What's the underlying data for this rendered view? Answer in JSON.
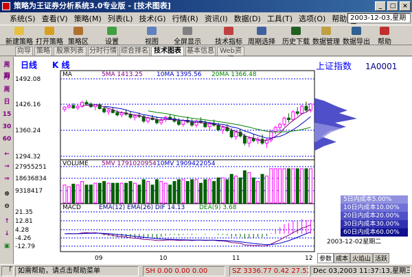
{
  "window": {
    "title": "策略为王证券分析系统3.0专业版 - [技术图表]"
  },
  "menu": [
    "系统(S)",
    "查看(V)",
    "策略(M)",
    "列表(L)",
    "技术(G)",
    "行情(R)",
    "资讯(I)",
    "数据(D)",
    "工具(T)",
    "选项(O)",
    "帮助(H)"
  ],
  "date_display": "2003-12-03,星期三",
  "toolbar": [
    "新建策略",
    "打开策略",
    "策略区",
    "设置",
    "视图",
    "全屏显示",
    "技术指标",
    "周期选择",
    "历史下载",
    "数据管理",
    "数据导出",
    "帮助"
  ],
  "tabs": [
    "向导",
    "策略",
    "股票列表",
    "分时行情",
    "综合排名",
    "技术图表",
    "基本信息",
    "Web资讯"
  ],
  "active_tab": "技术图表",
  "left_tools": [
    "周期",
    "月",
    "周",
    "日",
    "15",
    "30",
    "60",
    "←",
    "→",
    "⇒",
    "⊕",
    "⊖",
    "↑",
    "↓",
    "▣"
  ],
  "chart": {
    "period_label": "日线",
    "type_label": "K  线",
    "stock_name": "上证指数",
    "stock_code": "1A0001",
    "ma_label": "MA",
    "ma5": "5MA 1413.25",
    "ma10": "10MA 1395.56",
    "ma20": "20MA 1366.48",
    "price_axis": [
      "1492.08",
      "1426.16",
      "1360.24",
      "1294.32"
    ],
    "volume_label": "VOLUME",
    "mv5": "5MV 1791020954",
    "mv10": "10MV 1909422054",
    "vol_axis": [
      "27955251",
      "18636834",
      "9318417"
    ],
    "macd_label": "MACD",
    "macd_params": "EMA(12) EMA(26) DIF 14.13",
    "dea_label": "DEA(9) 3.68",
    "macd_axis": [
      "21.35",
      "12.81",
      "4.28",
      "-4.26",
      "-12.79"
    ],
    "x_axis": [
      "09",
      "10",
      "11",
      "12"
    ],
    "cost_legend": [
      "5日内成本5.00%",
      "10日内成本10.00%",
      "20日内成本20.00%",
      "30日内成本30.00%",
      "60日内成本60.00%"
    ],
    "cost_date": "2003-12-02星期二",
    "side_tabs": [
      "参数",
      "成本",
      "火焰山",
      "活跃"
    ],
    "colors": {
      "up": "#ff00ff",
      "down": "#006000",
      "ma5": "#800080",
      "ma10": "#0000c0",
      "ma20": "#008000",
      "grid": "#0000ff"
    },
    "chart_data": {
      "type": "candlestick",
      "candles": [
        [
          1414,
          1422,
          1408,
          1420
        ],
        [
          1420,
          1428,
          1416,
          1424
        ],
        [
          1424,
          1430,
          1415,
          1418
        ],
        [
          1418,
          1426,
          1412,
          1422
        ],
        [
          1422,
          1436,
          1418,
          1432
        ],
        [
          1432,
          1438,
          1424,
          1428
        ],
        [
          1428,
          1432,
          1418,
          1421
        ],
        [
          1421,
          1428,
          1412,
          1426
        ],
        [
          1426,
          1430,
          1414,
          1416
        ],
        [
          1416,
          1422,
          1404,
          1408
        ],
        [
          1408,
          1416,
          1400,
          1412
        ],
        [
          1412,
          1420,
          1404,
          1406
        ],
        [
          1406,
          1412,
          1396,
          1400
        ],
        [
          1400,
          1410,
          1394,
          1405
        ],
        [
          1405,
          1414,
          1398,
          1402
        ],
        [
          1402,
          1408,
          1390,
          1394
        ],
        [
          1394,
          1402,
          1386,
          1398
        ],
        [
          1398,
          1406,
          1392,
          1396
        ],
        [
          1396,
          1400,
          1380,
          1384
        ],
        [
          1384,
          1396,
          1378,
          1392
        ],
        [
          1392,
          1400,
          1386,
          1388
        ],
        [
          1388,
          1396,
          1376,
          1380
        ],
        [
          1380,
          1392,
          1374,
          1388
        ],
        [
          1388,
          1398,
          1382,
          1394
        ],
        [
          1394,
          1402,
          1388,
          1390
        ],
        [
          1390,
          1398,
          1380,
          1384
        ],
        [
          1384,
          1392,
          1372,
          1376
        ],
        [
          1376,
          1390,
          1370,
          1386
        ],
        [
          1386,
          1396,
          1378,
          1382
        ],
        [
          1382,
          1390,
          1370,
          1374
        ],
        [
          1374,
          1388,
          1368,
          1384
        ],
        [
          1384,
          1394,
          1378,
          1380
        ],
        [
          1380,
          1386,
          1366,
          1370
        ],
        [
          1370,
          1382,
          1362,
          1378
        ],
        [
          1378,
          1388,
          1370,
          1374
        ],
        [
          1374,
          1380,
          1358,
          1362
        ],
        [
          1362,
          1374,
          1352,
          1368
        ],
        [
          1368,
          1376,
          1356,
          1360
        ],
        [
          1360,
          1366,
          1340,
          1344
        ],
        [
          1344,
          1360,
          1336,
          1356
        ],
        [
          1356,
          1364,
          1342,
          1346
        ],
        [
          1346,
          1352,
          1322,
          1328
        ],
        [
          1328,
          1346,
          1318,
          1340
        ],
        [
          1340,
          1352,
          1330,
          1334
        ],
        [
          1334,
          1344,
          1326,
          1338
        ],
        [
          1338,
          1350,
          1324,
          1328
        ],
        [
          1328,
          1340,
          1316,
          1336
        ],
        [
          1336,
          1362,
          1330,
          1358
        ],
        [
          1358,
          1372,
          1350,
          1368
        ],
        [
          1368,
          1380,
          1358,
          1376
        ],
        [
          1376,
          1396,
          1370,
          1392
        ],
        [
          1392,
          1404,
          1380,
          1388
        ],
        [
          1388,
          1412,
          1384,
          1408
        ],
        [
          1408,
          1420,
          1398,
          1404
        ],
        [
          1404,
          1426,
          1400,
          1422
        ],
        [
          1422,
          1434,
          1408,
          1412
        ],
        [
          1412,
          1430,
          1406,
          1428
        ]
      ]
    }
  },
  "status": {
    "help": "如需帮助，请点击帮助菜单",
    "sh": "SH  0.00  0.00  0.00",
    "sz": "SZ  3336.77  0.42  27.52",
    "time": "Dec 03,2003 11:37:13,星期三"
  }
}
